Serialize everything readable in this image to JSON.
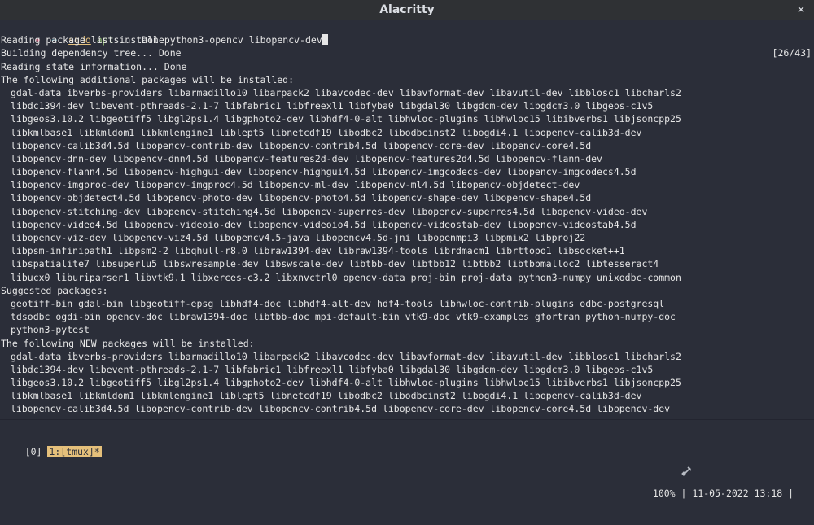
{
  "window": {
    "title": "Alacritty"
  },
  "prompt": {
    "arrow": "➜",
    "cwd": "~",
    "sudo": "sudo",
    "apt": "apt",
    "args": "install python3-opencv libopencv-dev",
    "counter": "[26/43]"
  },
  "output": {
    "status_lines": [
      "Reading package lists... Done",
      "Building dependency tree... Done",
      "Reading state information... Done"
    ],
    "additional_header": "The following additional packages will be installed:",
    "additional": [
      "gdal-data ibverbs-providers libarmadillo10 libarpack2 libavcodec-dev libavformat-dev libavutil-dev libblosc1 libcharls2",
      "libdc1394-dev libevent-pthreads-2.1-7 libfabric1 libfreexl1 libfyba0 libgdal30 libgdcm-dev libgdcm3.0 libgeos-c1v5",
      "libgeos3.10.2 libgeotiff5 libgl2ps1.4 libgphoto2-dev libhdf4-0-alt libhwloc-plugins libhwloc15 libibverbs1 libjsoncpp25",
      "libkmlbase1 libkmldom1 libkmlengine1 liblept5 libnetcdf19 libodbc2 libodbcinst2 libogdi4.1 libopencv-calib3d-dev",
      "libopencv-calib3d4.5d libopencv-contrib-dev libopencv-contrib4.5d libopencv-core-dev libopencv-core4.5d",
      "libopencv-dnn-dev libopencv-dnn4.5d libopencv-features2d-dev libopencv-features2d4.5d libopencv-flann-dev",
      "libopencv-flann4.5d libopencv-highgui-dev libopencv-highgui4.5d libopencv-imgcodecs-dev libopencv-imgcodecs4.5d",
      "libopencv-imgproc-dev libopencv-imgproc4.5d libopencv-ml-dev libopencv-ml4.5d libopencv-objdetect-dev",
      "libopencv-objdetect4.5d libopencv-photo-dev libopencv-photo4.5d libopencv-shape-dev libopencv-shape4.5d",
      "libopencv-stitching-dev libopencv-stitching4.5d libopencv-superres-dev libopencv-superres4.5d libopencv-video-dev",
      "libopencv-video4.5d libopencv-videoio-dev libopencv-videoio4.5d libopencv-videostab-dev libopencv-videostab4.5d",
      "libopencv-viz-dev libopencv-viz4.5d libopencv4.5-java libopencv4.5d-jni libopenmpi3 libpmix2 libproj22",
      "libpsm-infinipath1 libpsm2-2 libqhull-r8.0 libraw1394-dev libraw1394-tools librdmacm1 librttopo1 libsocket++1",
      "libspatialite7 libsuperlu5 libswresample-dev libswscale-dev libtbb-dev libtbb12 libtbb2 libtbbmalloc2 libtesseract4",
      "libucx0 liburiparser1 libvtk9.1 libxerces-c3.2 libxnvctrl0 opencv-data proj-bin proj-data python3-numpy unixodbc-common"
    ],
    "suggested_header": "Suggested packages:",
    "suggested": [
      "geotiff-bin gdal-bin libgeotiff-epsg libhdf4-doc libhdf4-alt-dev hdf4-tools libhwloc-contrib-plugins odbc-postgresql",
      "tdsodbc ogdi-bin opencv-doc libraw1394-doc libtbb-doc mpi-default-bin vtk9-doc vtk9-examples gfortran python-numpy-doc",
      "python3-pytest"
    ],
    "new_header": "The following NEW packages will be installed:",
    "new": [
      "gdal-data ibverbs-providers libarmadillo10 libarpack2 libavcodec-dev libavformat-dev libavutil-dev libblosc1 libcharls2",
      "libdc1394-dev libevent-pthreads-2.1-7 libfabric1 libfreexl1 libfyba0 libgdal30 libgdcm-dev libgdcm3.0 libgeos-c1v5",
      "libgeos3.10.2 libgeotiff5 libgl2ps1.4 libgphoto2-dev libhdf4-0-alt libhwloc-plugins libhwloc15 libibverbs1 libjsoncpp25",
      "libkmlbase1 libkmldom1 libkmlengine1 liblept5 libnetcdf19 libodbc2 libodbcinst2 libogdi4.1 libopencv-calib3d-dev",
      "libopencv-calib3d4.5d libopencv-contrib-dev libopencv-contrib4.5d libopencv-core-dev libopencv-core4.5d libopencv-dev"
    ]
  },
  "status_bar": {
    "session": "[0]",
    "window_tab": "1:[tmux]*",
    "battery": "100%",
    "separator": "|",
    "datetime": "11-05-2022 13:18"
  },
  "icons": {
    "close": "close-icon",
    "battery": "battery-icon",
    "status": "smile-icon"
  },
  "colors": {
    "background": "#2b2e39",
    "foreground": "#e6e6e6",
    "prompt_arrow": "#ec6a88",
    "prompt_cwd": "#6bc1d5",
    "sudo": "#e5c07b",
    "apt": "#98c379",
    "tmux_tab": "#e5c07b"
  }
}
